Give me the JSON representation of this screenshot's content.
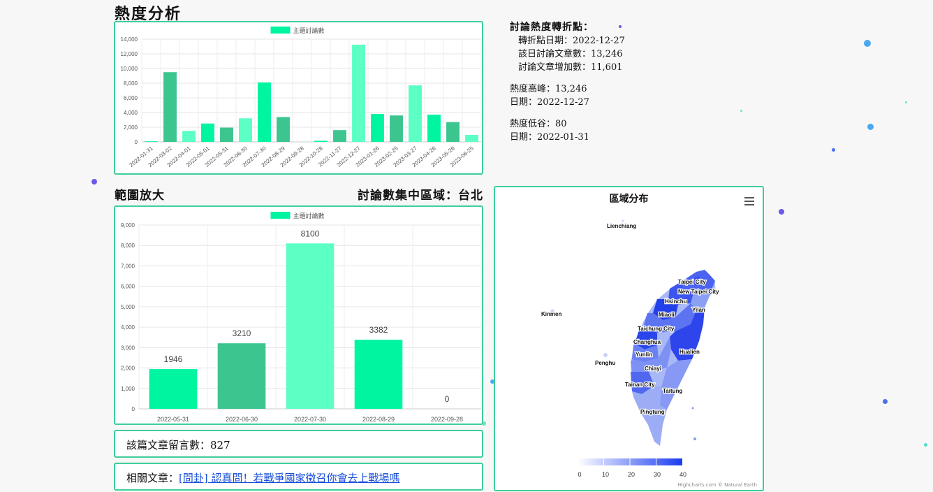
{
  "heat": {
    "title": "熱度分析",
    "legend_label": "主題討論數",
    "turning_title": "討論熱度轉折點：",
    "turning_date": "轉折點日期：2022-12-27",
    "turning_count": "該日討論文章數：13,246",
    "turning_increase": "討論文章增加數：11,601",
    "peak": "熱度高峰：13,246",
    "peak_date": "日期：2022-12-27",
    "low": "熱度低谷：80",
    "low_date": "日期：2022-01-31"
  },
  "zoom": {
    "title": "範圍放大",
    "region_text": "討論數集中區域：台北",
    "legend_label": "主題討論數"
  },
  "comments": {
    "text": "該篇文章留言數：827"
  },
  "related": {
    "label": "相關文章：",
    "link": "[問卦] 認真問！若戰爭國家徵召你會去上戰場嗎"
  },
  "map": {
    "title": "區域分布",
    "credit": "Highcharts.com © Natural Earth",
    "legend_ticks": [
      "0",
      "10",
      "20",
      "30",
      "40"
    ],
    "region_labels": [
      "Lienchiang",
      "Kinmen",
      "Penghu",
      "Taipei City",
      "New Taipei City",
      "Hsinchu",
      "Yilan",
      "Miaoli",
      "Taichung City",
      "Changhua",
      "Hualien",
      "Yunlin",
      "Chiayi",
      "Tainan City",
      "Taitung",
      "Pingtung"
    ]
  },
  "colors": {
    "accent": "#3ecf9a",
    "bar_green": "#00f5a0",
    "bar_dark": "#3cc58e",
    "bar_light": "#5cffc4",
    "map_blue": "#2244ee"
  },
  "chart_data": [
    {
      "type": "bar",
      "title": "",
      "categories": [
        "2022-01-31",
        "2022-03-02",
        "2022-04-01",
        "2022-05-01",
        "2022-05-31",
        "2022-06-30",
        "2022-07-30",
        "2022-08-29",
        "2022-09-28",
        "2022-10-28",
        "2022-11-27",
        "2022-12-27",
        "2023-01-26",
        "2023-02-25",
        "2023-03-27",
        "2023-04-26",
        "2023-05-26",
        "2023-06-25"
      ],
      "series": [
        {
          "name": "主題討論數",
          "values": [
            80,
            9500,
            1500,
            2500,
            1946,
            3210,
            8100,
            3382,
            0,
            150,
            1600,
            13246,
            3800,
            3600,
            7700,
            3700,
            2700,
            950
          ]
        }
      ],
      "yticks": [
        "0",
        "2,000",
        "4,000",
        "6,000",
        "8,000",
        "10,000",
        "12,000",
        "14,000"
      ],
      "ylim": [
        0,
        14000
      ],
      "grid": true,
      "legend": "top"
    },
    {
      "type": "bar",
      "title": "",
      "categories": [
        "2022-05-31",
        "2022-06-30",
        "2022-07-30",
        "2022-08-29",
        "2022-09-28"
      ],
      "series": [
        {
          "name": "主題討論數",
          "values": [
            1946,
            3210,
            8100,
            3382,
            0
          ]
        }
      ],
      "data_labels": [
        "1946",
        "3210",
        "8100",
        "3382",
        "0"
      ],
      "yticks": [
        "0",
        "1,000",
        "2,000",
        "3,000",
        "4,000",
        "5,000",
        "6,000",
        "7,000",
        "8,000",
        "9,000"
      ],
      "ylim": [
        0,
        9000
      ],
      "grid": true,
      "legend": "top"
    }
  ]
}
